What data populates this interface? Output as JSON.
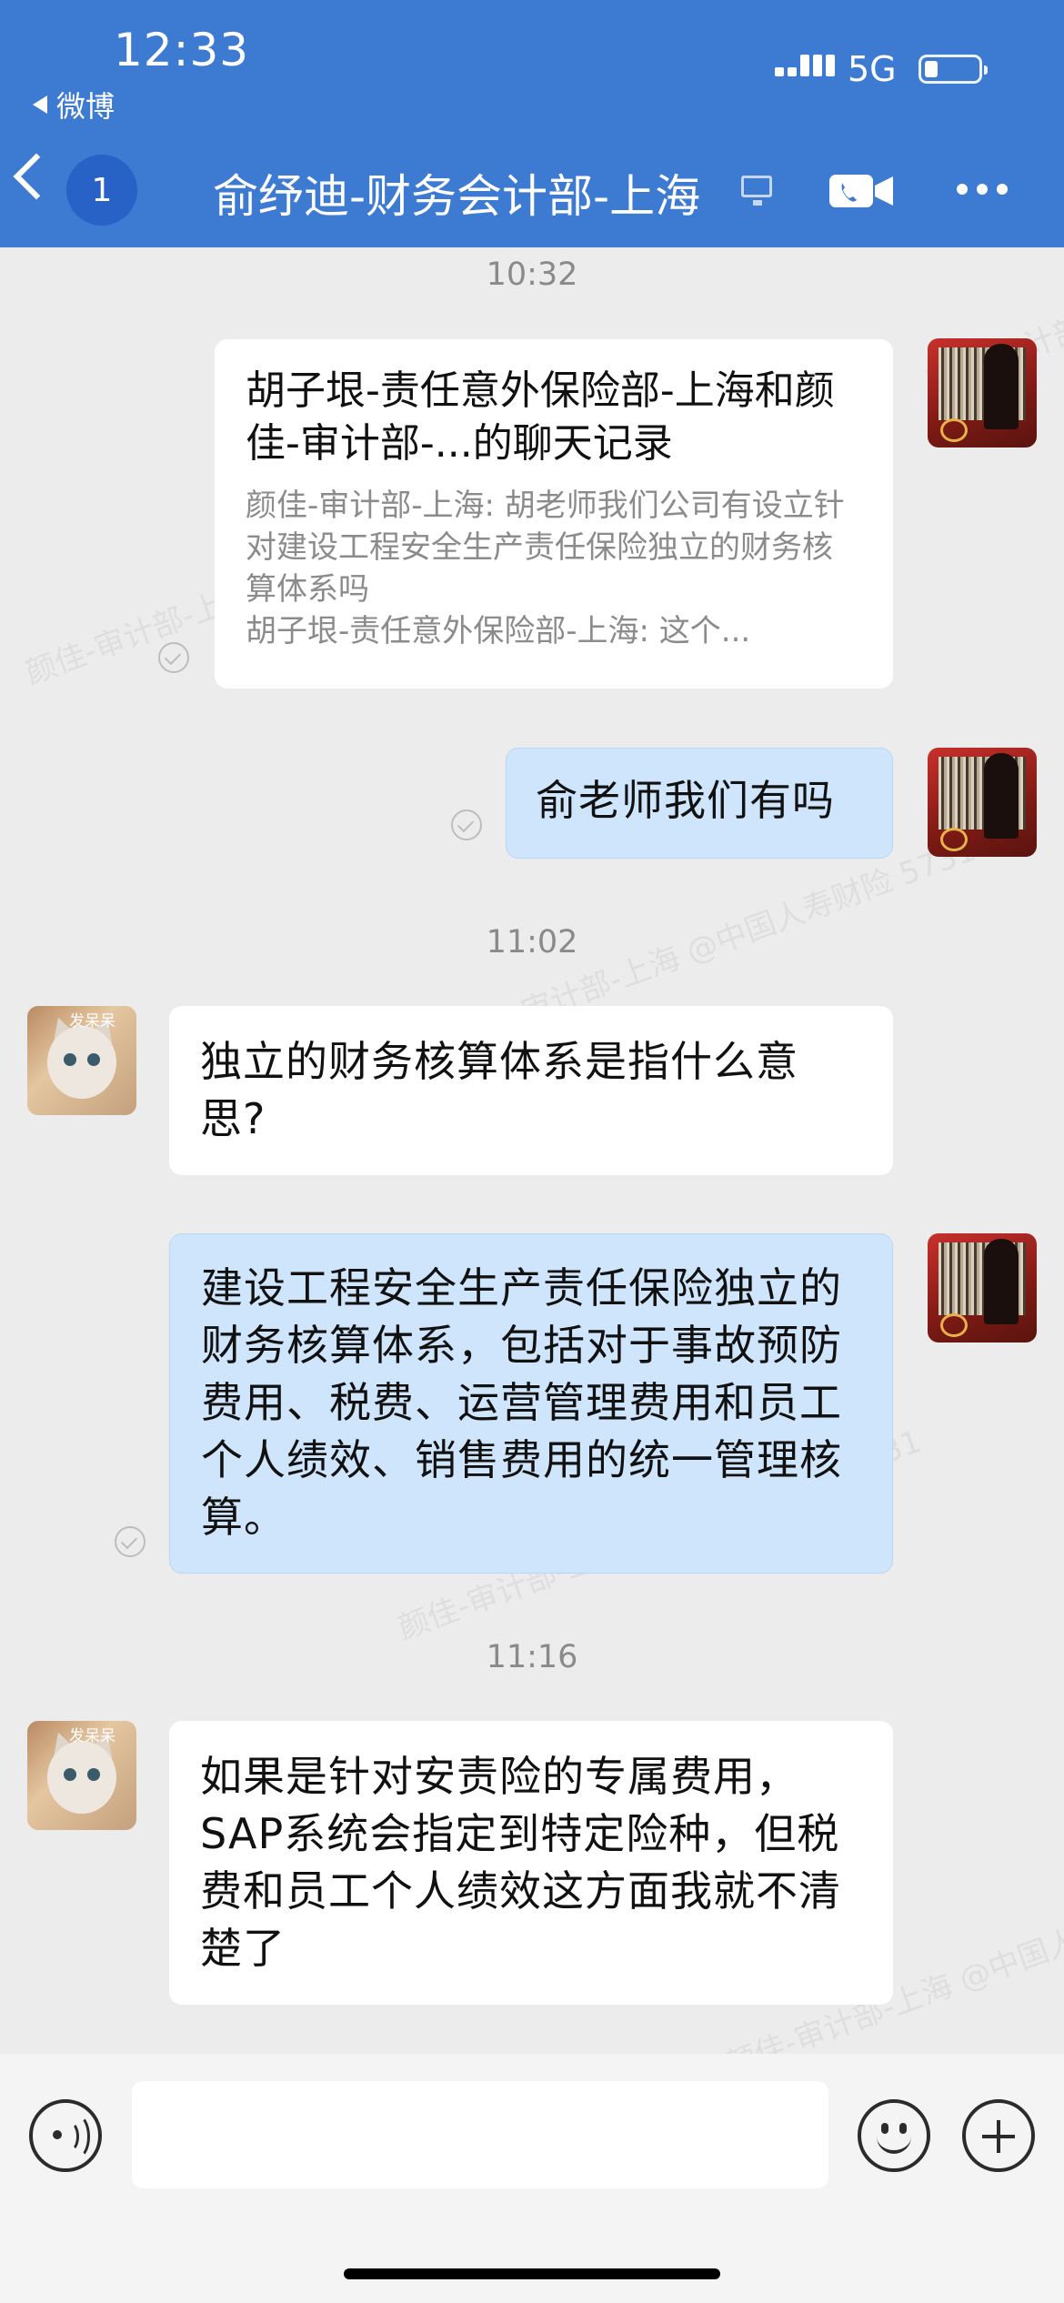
{
  "status_bar": {
    "time": "12:33",
    "back_app": "微博",
    "network": "5G"
  },
  "header": {
    "unread_count": "1",
    "title": "俞纾迪-财务会计部-上海"
  },
  "watermark": "颜佳-审计部-上海 @中国人寿财险 5731",
  "messages": [
    {
      "timestamp": "10:32"
    },
    {
      "record_title": "胡子垠-责任意外保险部-上海和颜佳-审计部-...的聊天记录",
      "record_lines": [
        "颜佳-审计部-上海: 胡老师我们公司有设立针对建设工程安全生产责任保险独立的财务核算体系吗",
        "胡子垠-责任意外保险部-上海: 这个..."
      ]
    },
    {
      "text": "俞老师我们有吗"
    },
    {
      "timestamp": "11:02"
    },
    {
      "text": "独立的财务核算体系是指什么意思?"
    },
    {
      "text": "建设工程安全生产责任保险独立的财务核算体系，包括对于事故预防费用、税费、运营管理费用和员工个人绩效、销售费用的统一管理核算。"
    },
    {
      "timestamp": "11:16"
    },
    {
      "text": "如果是针对安责险的专属费用，SAP系统会指定到特定险种，但税费和员工个人绩效这方面我就不清楚了"
    }
  ],
  "avatars": {
    "cat_tag": "发呆呆"
  },
  "composer": {
    "value": "",
    "placeholder": ""
  },
  "colors": {
    "header": "#3d7bd2",
    "bubble_self": "#cfe5fb",
    "bubble_other": "#ffffff",
    "background": "#ececec"
  }
}
